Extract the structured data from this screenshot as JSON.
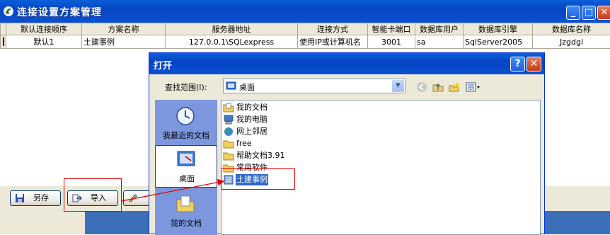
{
  "window": {
    "title": "连接设置方案管理",
    "buttons": {
      "minimize": "_",
      "maximize": "□",
      "close": "✕"
    }
  },
  "grid": {
    "headers": [
      "默认连接顺序",
      "方案名称",
      "服务器地址",
      "连接方式",
      "智能卡端口",
      "数据库用户",
      "数据库引擎",
      "数据库名称"
    ],
    "rows": [
      [
        "默认1",
        "土建事例",
        "127.0.0.1\\SQLexpress",
        "使用IP或计算机名",
        "3001",
        "sa",
        "SqlServer2005",
        "Jzgdgl"
      ]
    ]
  },
  "toolbar": {
    "save_as": "另存",
    "import": "导入"
  },
  "dialog": {
    "title": "打开",
    "buttons": {
      "help": "?",
      "close": "✕"
    },
    "lookin_label": "查找范围(I):",
    "lookin_value": "桌面",
    "places": [
      "我最近的文档",
      "桌面",
      "我的文档"
    ],
    "files": [
      "我的文档",
      "我的电脑",
      "网上邻居",
      "free",
      "帮助文档3.91",
      "常用软件",
      "土建事例"
    ],
    "selected_file": "土建事例"
  },
  "colors": {
    "titlebar": "#0a51d2",
    "highlight": "#316ac5",
    "annotation_red": "#e00000",
    "places_bg": "#7c97dd"
  },
  "icons": {
    "app": "app-logo-icon",
    "folder": "folder-icon",
    "back": "back-arrow-icon",
    "up": "up-folder-icon",
    "new_folder": "new-folder-icon",
    "views": "views-menu-icon"
  }
}
